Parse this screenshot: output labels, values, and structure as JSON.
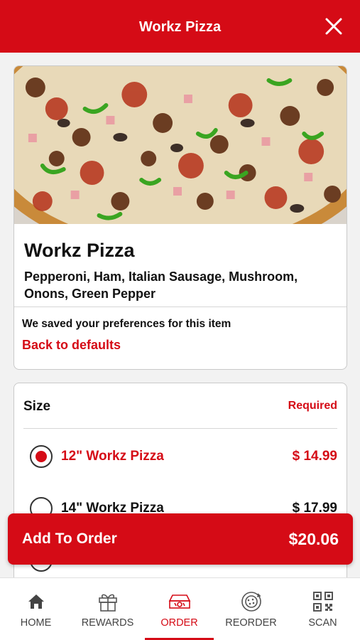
{
  "header": {
    "title": "Workz Pizza"
  },
  "item": {
    "name": "Workz Pizza",
    "description": "Pepperoni, Ham, Italian Sausage, Mushroom, Onons, Green Pepper",
    "preferences_notice": "We saved your preferences for this item",
    "back_to_defaults": "Back to defaults"
  },
  "size": {
    "label": "Size",
    "required": "Required",
    "options": [
      {
        "name": "12\" Workz Pizza",
        "price": "$ 14.99",
        "selected": true
      },
      {
        "name": "14\" Workz Pizza",
        "price": "$ 17.99",
        "selected": false
      }
    ]
  },
  "add_to_order": {
    "label": "Add To Order",
    "price": "$20.06"
  },
  "nav": {
    "items": [
      {
        "label": "HOME",
        "icon": "home-icon"
      },
      {
        "label": "REWARDS",
        "icon": "gift-icon"
      },
      {
        "label": "ORDER",
        "icon": "pizza-box-icon",
        "active": true
      },
      {
        "label": "REORDER",
        "icon": "reorder-icon"
      },
      {
        "label": "SCAN",
        "icon": "qr-code-icon"
      }
    ]
  },
  "colors": {
    "brand_red": "#d50b16",
    "background": "#f2f2f2"
  }
}
